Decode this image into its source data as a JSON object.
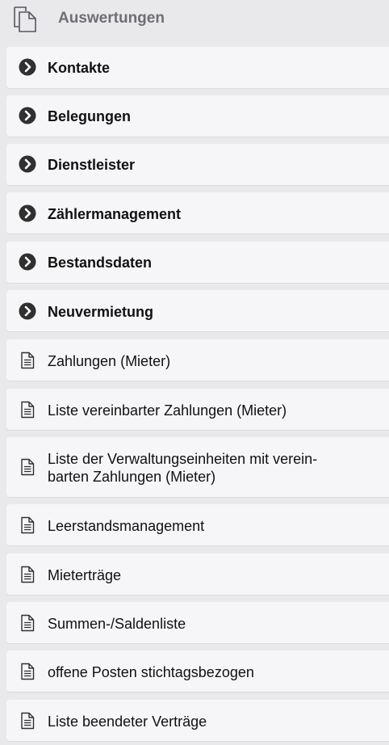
{
  "header": {
    "title": "Auswertungen",
    "icon": "documents-copy-icon"
  },
  "folders": [
    {
      "label": "Kontakte",
      "icon": "chevron-right-circle-icon"
    },
    {
      "label": "Belegungen",
      "icon": "chevron-right-circle-icon"
    },
    {
      "label": "Dienstleister",
      "icon": "chevron-right-circle-icon"
    },
    {
      "label": "Zählermanagement",
      "icon": "chevron-right-circle-icon"
    },
    {
      "label": "Bestandsdaten",
      "icon": "chevron-right-circle-icon"
    },
    {
      "label": "Neuvermietung",
      "icon": "chevron-right-circle-icon"
    }
  ],
  "reports": [
    {
      "label": "Zahlungen (Mieter)",
      "icon": "document-icon"
    },
    {
      "label": "Liste vereinbarter Zahlungen (Mieter)",
      "icon": "document-icon"
    },
    {
      "label": "Liste der Verwaltungseinheiten mit verein-\nbarten Zahlungen (Mieter)",
      "icon": "document-icon"
    },
    {
      "label": "Leerstandsmanagement",
      "icon": "document-icon"
    },
    {
      "label": "Mieterträge",
      "icon": "document-icon"
    },
    {
      "label": "Summen-/Saldenliste",
      "icon": "document-icon"
    },
    {
      "label": "offene Posten stichtagsbezogen",
      "icon": "document-icon"
    },
    {
      "label": "Liste beendeter Verträge",
      "icon": "document-icon"
    }
  ],
  "colors": {
    "background": "#e9e9eb",
    "row": "#f6f6f8",
    "header_text": "#6d6f76",
    "folder_icon": "#303030"
  }
}
